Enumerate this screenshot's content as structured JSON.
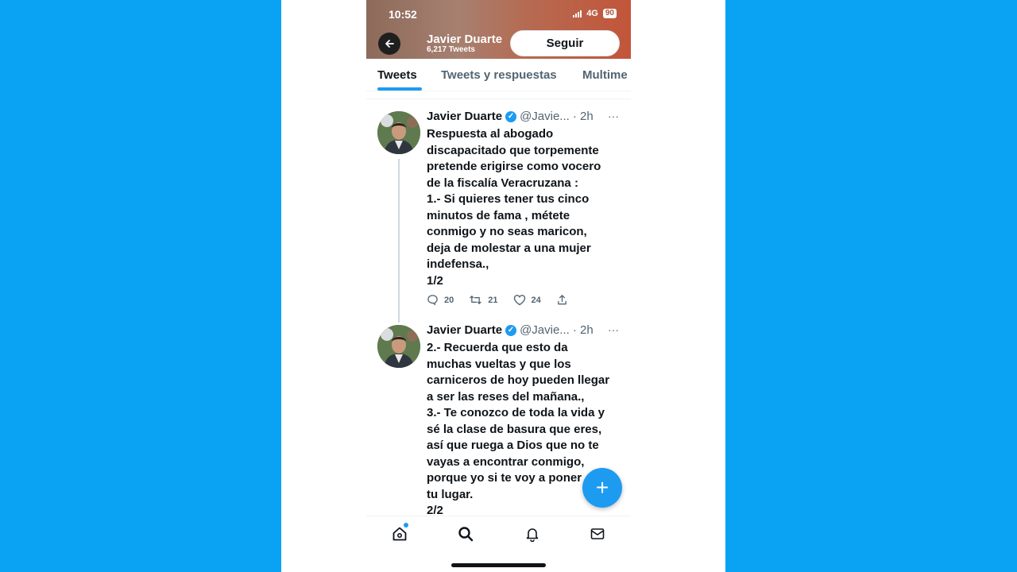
{
  "status_bar": {
    "time": "10:52",
    "network": "4G",
    "battery": "90"
  },
  "header": {
    "name": "Javier Duarte",
    "tweet_count": "6,217 Tweets",
    "follow_label": "Seguir"
  },
  "tabs": [
    {
      "label": "Tweets",
      "active": true
    },
    {
      "label": "Tweets y respuestas",
      "active": false
    },
    {
      "label": "Multime",
      "active": false
    }
  ],
  "tweets": [
    {
      "name": "Javier Duarte",
      "handle": "@Javie...",
      "time": "· 2h",
      "more": "···",
      "body": "Respuesta al abogado\ndiscapacitado que torpemente\npretende erigirse como vocero\nde la fiscalía Veracruzana :\n1.- Si quieres tener tus cinco\nminutos de fama , métete\nconmigo y no seas maricon,\ndeja de molestar a una mujer\nindefensa.,\n1/2",
      "replies": "20",
      "retweets": "21",
      "likes": "24"
    },
    {
      "name": "Javier Duarte",
      "handle": "@Javie...",
      "time": "· 2h",
      "more": "···",
      "body": "2.- Recuerda que esto da\nmuchas vueltas y que los\ncarniceros de hoy pueden llegar\na ser las reses del mañana.,\n3.- Te conozco de toda la vida y\nsé la clase de basura que eres,\nasí que ruega a Dios que no te\nvayas a encontrar conmigo,\nporque yo si te voy a poner\ntu lugar.\n2/2"
    }
  ],
  "fab": {
    "icon": "plus-icon",
    "glyph": "+"
  },
  "colors": {
    "accent": "#1d9bf0",
    "background": "#0aa3f3"
  },
  "bottom_nav": [
    "home-icon",
    "search-icon",
    "bell-icon",
    "mail-icon"
  ]
}
